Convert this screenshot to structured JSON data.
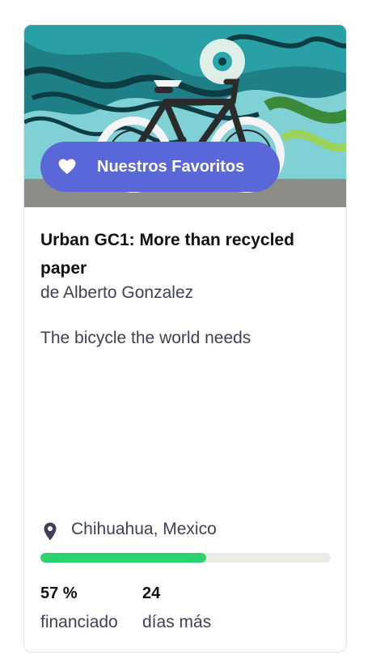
{
  "card": {
    "badge_label": "Nuestros Favoritos",
    "title": "Urban GC1: More than recycled paper",
    "author": "de Alberto Gonzalez",
    "blurb": "The bicycle the world needs",
    "location": "Chihuahua, Mexico",
    "progress_fraction": 0.57,
    "stats": {
      "funded_value": "57 %",
      "funded_label": "financiado",
      "days_value": "24",
      "days_label": "días más"
    }
  },
  "colors": {
    "badge": "#5a67d8",
    "progress_fill": "#2bd46f",
    "progress_track": "#eeebe6",
    "text_secondary": "#3e4155"
  },
  "icons": {
    "badge": "heart-icon",
    "location": "map-pin-icon"
  }
}
